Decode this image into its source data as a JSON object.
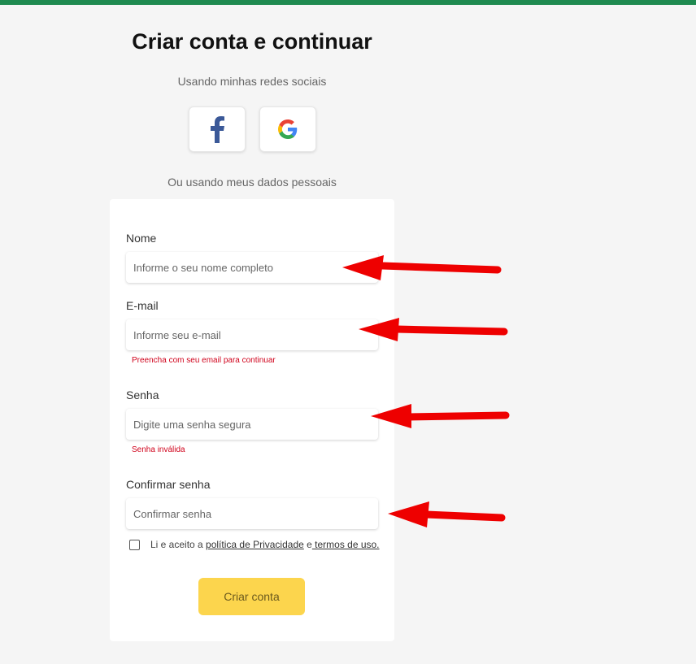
{
  "colors": {
    "top_bar": "#1f8a50",
    "button": "#fcd54d",
    "error": "#d0021b",
    "annotation_arrow": "#ee0000",
    "facebook": "#3b5998"
  },
  "header": {
    "title": "Criar conta e continuar",
    "social_subtitle": "Usando minhas redes sociais",
    "personal_subtitle": "Ou usando meus dados pessoais"
  },
  "social": {
    "facebook_icon": "facebook-icon",
    "google_icon": "google-icon"
  },
  "form": {
    "name": {
      "label": "Nome",
      "placeholder": "Informe o seu nome completo",
      "value": ""
    },
    "email": {
      "label": "E-mail",
      "placeholder": "Informe seu e-mail",
      "value": "",
      "error": "Preencha com seu email para continuar"
    },
    "password": {
      "label": "Senha",
      "placeholder": "Digite uma senha segura",
      "value": "",
      "error": "Senha inválida"
    },
    "confirm": {
      "label": "Confirmar senha",
      "placeholder": "Confirmar senha",
      "value": ""
    },
    "terms": {
      "prefix": "Li e aceito a ",
      "privacy_link": "política de Privacidade",
      "middle": " e",
      "terms_link": " termos de uso.",
      "checked": false
    },
    "submit_label": "Criar conta"
  }
}
